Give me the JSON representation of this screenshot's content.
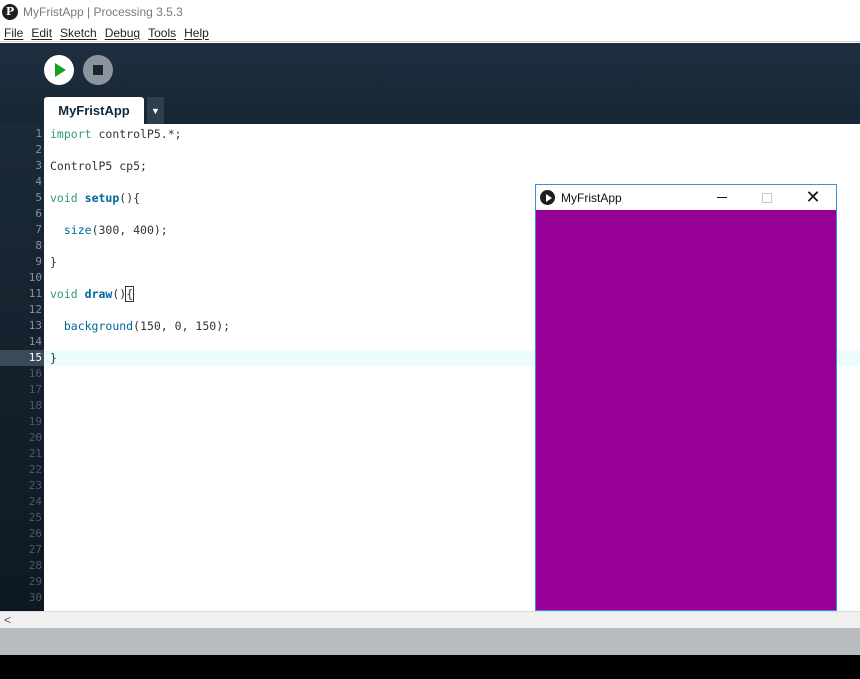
{
  "window": {
    "title": "MyFristApp | Processing 3.5.3",
    "logo_letter": "P"
  },
  "menu": [
    "File",
    "Edit",
    "Sketch",
    "Debug",
    "Tools",
    "Help"
  ],
  "toolbar": {
    "run_icon": "play-icon",
    "stop_icon": "stop-icon"
  },
  "tab": {
    "label": "MyFristApp",
    "menu_glyph": "▼"
  },
  "editor": {
    "current_line": 15,
    "line_numbers": [
      "1",
      "2",
      "3",
      "4",
      "5",
      "6",
      "7",
      "8",
      "9",
      "10",
      "11",
      "12",
      "13",
      "14",
      "15",
      "16",
      "17",
      "18",
      "19",
      "20",
      "21",
      "22",
      "23",
      "24",
      "25",
      "26",
      "27",
      "28",
      "29",
      "30"
    ],
    "code": [
      "import controlP5.*;",
      "",
      "ControlP5 cp5;",
      "",
      "void setup(){",
      "",
      "  size(300, 400);",
      "",
      "}",
      "",
      "void draw(){",
      "",
      "  background(150, 0, 150);",
      "",
      "}"
    ]
  },
  "scroll": {
    "left_arrow": "<"
  },
  "sketch_window": {
    "title": "MyFristApp",
    "close_glyph": "✕",
    "background_color": "#960096"
  },
  "colors": {
    "keyword": "#33997e",
    "function": "#006699",
    "current_line": "#ebfcfc"
  }
}
